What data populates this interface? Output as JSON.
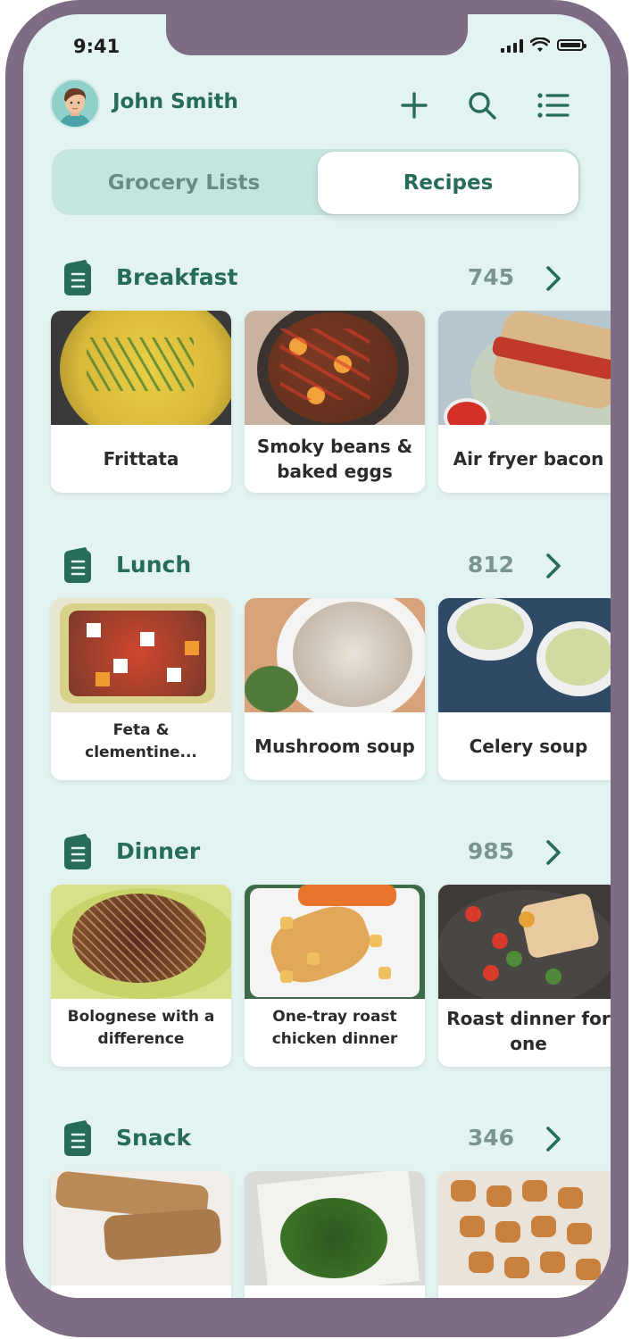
{
  "status_bar": {
    "time": "9:41"
  },
  "header": {
    "user_name": "John Smith",
    "avatar_icon": "user-avatar",
    "add_icon": "plus-icon",
    "search_icon": "search-icon",
    "menu_icon": "list-icon"
  },
  "tabs": [
    {
      "label": "Grocery Lists",
      "active": false
    },
    {
      "label": "Recipes",
      "active": true
    }
  ],
  "colors": {
    "brand": "#276b5a",
    "background": "#e3f3f1",
    "frame": "#7e6b84",
    "count": "#7a9590"
  },
  "sections": [
    {
      "title": "Breakfast",
      "count": "745",
      "icon": "recipe-book-icon",
      "recipes": [
        {
          "name": "Frittata"
        },
        {
          "name": "Smoky beans & baked eggs"
        },
        {
          "name": "Air fryer bacon"
        }
      ]
    },
    {
      "title": "Lunch",
      "count": "812",
      "icon": "recipe-book-icon",
      "recipes": [
        {
          "name": "Feta & clementine..."
        },
        {
          "name": "Mushroom soup"
        },
        {
          "name": "Celery soup"
        }
      ]
    },
    {
      "title": "Dinner",
      "count": "985",
      "icon": "recipe-book-icon",
      "recipes": [
        {
          "name": "Bolognese with a difference"
        },
        {
          "name": "One-tray roast chicken dinner"
        },
        {
          "name": "Roast dinner for one"
        }
      ]
    },
    {
      "title": "Snack",
      "count": "346",
      "icon": "recipe-book-icon",
      "recipes": [
        {
          "name": ""
        },
        {
          "name": ""
        },
        {
          "name": ""
        }
      ]
    }
  ]
}
